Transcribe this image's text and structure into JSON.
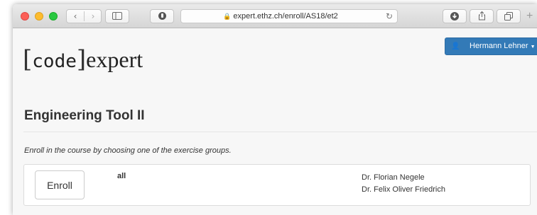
{
  "browser": {
    "url": "expert.ethz.ch/enroll/AS18/et2",
    "new_tab_symbol": "+",
    "reload_symbol": "↻"
  },
  "header": {
    "logo": {
      "left_bracket": "[",
      "code": "code",
      "right_bracket": "]",
      "word": "expert"
    },
    "user_name": "Hermann Lehner"
  },
  "course": {
    "title": "Engineering Tool II",
    "instructions": "Enroll in the course by choosing one of the exercise groups."
  },
  "groups": [
    {
      "enroll_label": "Enroll",
      "name": "all",
      "assistants": [
        "Dr. Florian Negele",
        "Dr. Felix Oliver Friedrich"
      ]
    }
  ],
  "colors": {
    "user_button": "#337ab7",
    "traffic_red": "#fc5f57",
    "traffic_yellow": "#fdbc2e",
    "traffic_green": "#28c840"
  }
}
